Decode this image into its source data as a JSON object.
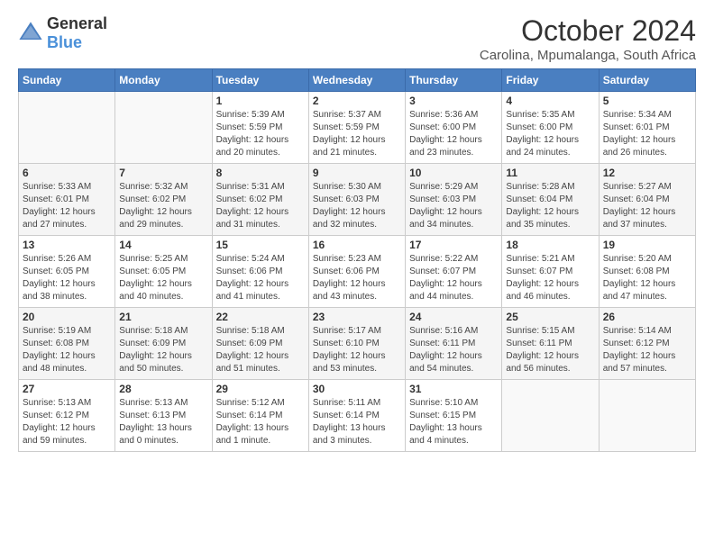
{
  "header": {
    "logo_general": "General",
    "logo_blue": "Blue",
    "title": "October 2024",
    "subtitle": "Carolina, Mpumalanga, South Africa"
  },
  "days_of_week": [
    "Sunday",
    "Monday",
    "Tuesday",
    "Wednesday",
    "Thursday",
    "Friday",
    "Saturday"
  ],
  "weeks": [
    [
      {
        "day": "",
        "info": ""
      },
      {
        "day": "",
        "info": ""
      },
      {
        "day": "1",
        "info": "Sunrise: 5:39 AM\nSunset: 5:59 PM\nDaylight: 12 hours\nand 20 minutes."
      },
      {
        "day": "2",
        "info": "Sunrise: 5:37 AM\nSunset: 5:59 PM\nDaylight: 12 hours\nand 21 minutes."
      },
      {
        "day": "3",
        "info": "Sunrise: 5:36 AM\nSunset: 6:00 PM\nDaylight: 12 hours\nand 23 minutes."
      },
      {
        "day": "4",
        "info": "Sunrise: 5:35 AM\nSunset: 6:00 PM\nDaylight: 12 hours\nand 24 minutes."
      },
      {
        "day": "5",
        "info": "Sunrise: 5:34 AM\nSunset: 6:01 PM\nDaylight: 12 hours\nand 26 minutes."
      }
    ],
    [
      {
        "day": "6",
        "info": "Sunrise: 5:33 AM\nSunset: 6:01 PM\nDaylight: 12 hours\nand 27 minutes."
      },
      {
        "day": "7",
        "info": "Sunrise: 5:32 AM\nSunset: 6:02 PM\nDaylight: 12 hours\nand 29 minutes."
      },
      {
        "day": "8",
        "info": "Sunrise: 5:31 AM\nSunset: 6:02 PM\nDaylight: 12 hours\nand 31 minutes."
      },
      {
        "day": "9",
        "info": "Sunrise: 5:30 AM\nSunset: 6:03 PM\nDaylight: 12 hours\nand 32 minutes."
      },
      {
        "day": "10",
        "info": "Sunrise: 5:29 AM\nSunset: 6:03 PM\nDaylight: 12 hours\nand 34 minutes."
      },
      {
        "day": "11",
        "info": "Sunrise: 5:28 AM\nSunset: 6:04 PM\nDaylight: 12 hours\nand 35 minutes."
      },
      {
        "day": "12",
        "info": "Sunrise: 5:27 AM\nSunset: 6:04 PM\nDaylight: 12 hours\nand 37 minutes."
      }
    ],
    [
      {
        "day": "13",
        "info": "Sunrise: 5:26 AM\nSunset: 6:05 PM\nDaylight: 12 hours\nand 38 minutes."
      },
      {
        "day": "14",
        "info": "Sunrise: 5:25 AM\nSunset: 6:05 PM\nDaylight: 12 hours\nand 40 minutes."
      },
      {
        "day": "15",
        "info": "Sunrise: 5:24 AM\nSunset: 6:06 PM\nDaylight: 12 hours\nand 41 minutes."
      },
      {
        "day": "16",
        "info": "Sunrise: 5:23 AM\nSunset: 6:06 PM\nDaylight: 12 hours\nand 43 minutes."
      },
      {
        "day": "17",
        "info": "Sunrise: 5:22 AM\nSunset: 6:07 PM\nDaylight: 12 hours\nand 44 minutes."
      },
      {
        "day": "18",
        "info": "Sunrise: 5:21 AM\nSunset: 6:07 PM\nDaylight: 12 hours\nand 46 minutes."
      },
      {
        "day": "19",
        "info": "Sunrise: 5:20 AM\nSunset: 6:08 PM\nDaylight: 12 hours\nand 47 minutes."
      }
    ],
    [
      {
        "day": "20",
        "info": "Sunrise: 5:19 AM\nSunset: 6:08 PM\nDaylight: 12 hours\nand 48 minutes."
      },
      {
        "day": "21",
        "info": "Sunrise: 5:18 AM\nSunset: 6:09 PM\nDaylight: 12 hours\nand 50 minutes."
      },
      {
        "day": "22",
        "info": "Sunrise: 5:18 AM\nSunset: 6:09 PM\nDaylight: 12 hours\nand 51 minutes."
      },
      {
        "day": "23",
        "info": "Sunrise: 5:17 AM\nSunset: 6:10 PM\nDaylight: 12 hours\nand 53 minutes."
      },
      {
        "day": "24",
        "info": "Sunrise: 5:16 AM\nSunset: 6:11 PM\nDaylight: 12 hours\nand 54 minutes."
      },
      {
        "day": "25",
        "info": "Sunrise: 5:15 AM\nSunset: 6:11 PM\nDaylight: 12 hours\nand 56 minutes."
      },
      {
        "day": "26",
        "info": "Sunrise: 5:14 AM\nSunset: 6:12 PM\nDaylight: 12 hours\nand 57 minutes."
      }
    ],
    [
      {
        "day": "27",
        "info": "Sunrise: 5:13 AM\nSunset: 6:12 PM\nDaylight: 12 hours\nand 59 minutes."
      },
      {
        "day": "28",
        "info": "Sunrise: 5:13 AM\nSunset: 6:13 PM\nDaylight: 13 hours\nand 0 minutes."
      },
      {
        "day": "29",
        "info": "Sunrise: 5:12 AM\nSunset: 6:14 PM\nDaylight: 13 hours\nand 1 minute."
      },
      {
        "day": "30",
        "info": "Sunrise: 5:11 AM\nSunset: 6:14 PM\nDaylight: 13 hours\nand 3 minutes."
      },
      {
        "day": "31",
        "info": "Sunrise: 5:10 AM\nSunset: 6:15 PM\nDaylight: 13 hours\nand 4 minutes."
      },
      {
        "day": "",
        "info": ""
      },
      {
        "day": "",
        "info": ""
      }
    ]
  ]
}
